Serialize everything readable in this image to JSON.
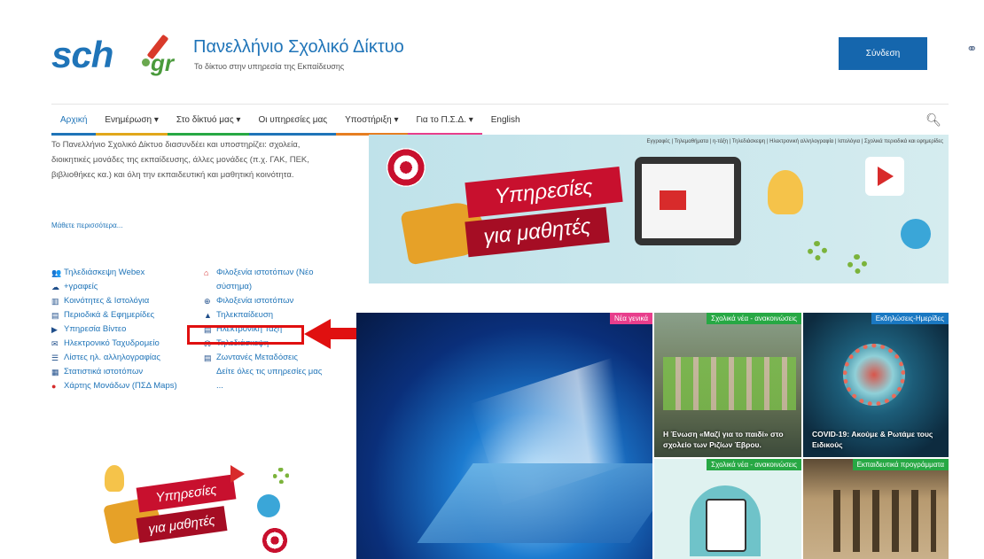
{
  "header": {
    "logo_sch": "sch",
    "logo_gr": "gr",
    "title": "Πανελλήνιο Σχολικό Δίκτυο",
    "subtitle": "Το δίκτυο στην υπηρεσία της Εκπαίδευσης",
    "login_label": "Σύνδεση",
    "accessibility_icon": "glasses-icon"
  },
  "nav": {
    "items": [
      {
        "label": "Αρχική",
        "color": "#1f74b8"
      },
      {
        "label": "Ενημέρωση ▾",
        "color": "#e1a71b"
      },
      {
        "label": "Στο δίκτυό μας ▾",
        "color": "#27a844"
      },
      {
        "label": "Οι υπηρεσίες μας",
        "color": "#1f74b8"
      },
      {
        "label": "Υποστήριξη ▾",
        "color": "#e67e22"
      },
      {
        "label": "Για το Π.Σ.Δ. ▾",
        "color": "#e83e8c"
      },
      {
        "label": "English",
        "color": "#1f74b8"
      }
    ],
    "search_icon": "search-icon"
  },
  "intro": {
    "text": "Το Πανελλήνιο Σχολικό Δίκτυο διασυνδέει και υποστηρίζει: σχολεία, διοικητικές μονάδες της εκπαίδευσης, άλλες μονάδες (π.χ. ΓΑΚ, ΠΕΚ, βιβλιοθήκες κα.) και όλη την εκπαιδευτική και μαθητική κοινότητα.",
    "more": "Μάθετε περισσότερα..."
  },
  "services": {
    "col1": [
      {
        "icon": "👥",
        "label": "Τηλεδιάσκεψη Webex"
      },
      {
        "icon": "☁",
        "label": "+γραφείς"
      },
      {
        "icon": "▥",
        "label": "Κοινότητες & Ιστολόγια"
      },
      {
        "icon": "▤",
        "label": "Περιοδικά & Εφημερίδες"
      },
      {
        "icon": "▶",
        "label": "Υπηρεσία Βίντεο"
      },
      {
        "icon": "✉",
        "label": "Ηλεκτρονικό Ταχυδρομείο"
      },
      {
        "icon": "☰",
        "label": "Λίστες ηλ. αλληλογραφίας"
      },
      {
        "icon": "▦",
        "label": "Στατιστικά ιστοτόπων"
      },
      {
        "icon": "●",
        "label": "Χάρτης Μονάδων (ΠΣΔ Maps)"
      }
    ],
    "col2": [
      {
        "icon": "⌂",
        "label": "Φιλοξενία ιστοτόπων (Νέο σύστημα)"
      },
      {
        "icon": "⊕",
        "label": "Φιλοξενία ιστοτόπων"
      },
      {
        "icon": "▲",
        "label": "Τηλεκπαίδευση"
      },
      {
        "icon": "▤",
        "label": "Ηλεκτρονική Τάξη"
      },
      {
        "icon": "☊",
        "label": "Τηλεδιάσκεψη"
      },
      {
        "icon": "▤",
        "label": "Ζωντανές Μεταδόσεις"
      },
      {
        "icon": "",
        "label": "Δείτε όλες τις υπηρεσίες μας ..."
      }
    ]
  },
  "hero": {
    "links": "Εγγραφές | Τηλεμαθήματα | η-τάξη | Τηλεδιάσκεψη | Ηλεκτρονική αλληλογραφία | Ιστολόγια | Σχολικά περιοδικά και εφημερίδες",
    "ribbon1": "Υπηρεσίες",
    "ribbon2": "για μαθητές"
  },
  "tiles": {
    "main_tag": "Νέα γενικά",
    "a_tag": "Σχολικά νέα - ανακοινώσεις",
    "a_caption": "Η Ένωση «Μαζί για το παιδί» στο σχολείο των Ριζίων Έβρου.",
    "b_tag": "Εκδηλώσεις-Ημερίδες",
    "b_caption": "COVID-19: Ακούμε & Ρωτάμε τους Ειδικούς",
    "c_tag": "Σχολικά νέα - ανακοινώσεις",
    "d_tag": "Εκπαιδευτικά προγράμματα"
  },
  "promo": {
    "ribbon1": "Υπηρεσίες",
    "ribbon2": "για μαθητές"
  }
}
